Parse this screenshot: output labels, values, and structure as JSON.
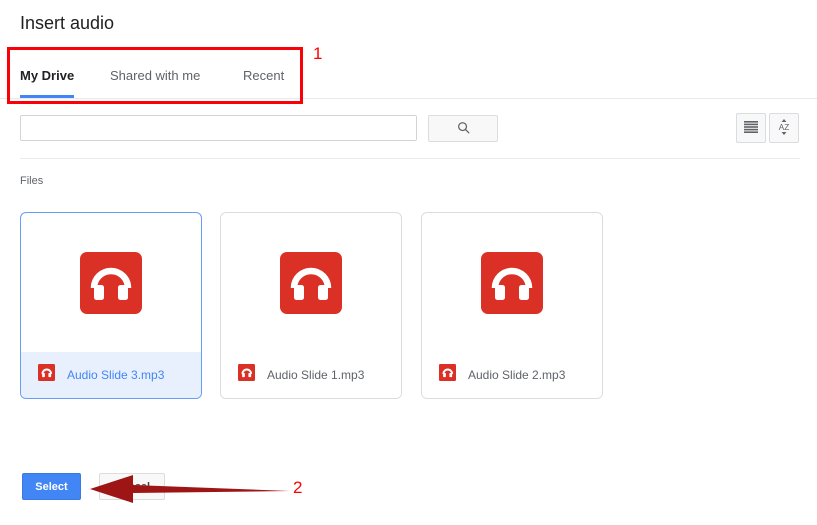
{
  "dialog": {
    "title": "Insert audio"
  },
  "tabs": [
    {
      "label": "My Drive",
      "active": true
    },
    {
      "label": "Shared with me",
      "active": false
    },
    {
      "label": "Recent",
      "active": false
    }
  ],
  "search": {
    "value": "",
    "placeholder": "",
    "search_button_icon": "search-icon"
  },
  "view_controls": [
    {
      "name": "list-view-icon",
      "label": "List view"
    },
    {
      "name": "sort-az-icon",
      "label": "Sort A-Z"
    }
  ],
  "section": {
    "files_label": "Files"
  },
  "files": [
    {
      "name": "Audio Slide 3.mp3",
      "selected": true,
      "icon": "audio-file-icon"
    },
    {
      "name": "Audio Slide 1.mp3",
      "selected": false,
      "icon": "audio-file-icon"
    },
    {
      "name": "Audio Slide 2.mp3",
      "selected": false,
      "icon": "audio-file-icon"
    }
  ],
  "footer": {
    "select_label": "Select",
    "cancel_label": "Cancel"
  },
  "annotations": [
    {
      "number": "1",
      "target": "tabs-strip"
    },
    {
      "number": "2",
      "target": "select-button"
    }
  ],
  "colors": {
    "accent_blue": "#4285f4",
    "audio_red": "#db3025",
    "annotation_red": "#fb0007",
    "arrow_dark_red": "#9d1515",
    "selected_bg": "#e8f0fe"
  }
}
